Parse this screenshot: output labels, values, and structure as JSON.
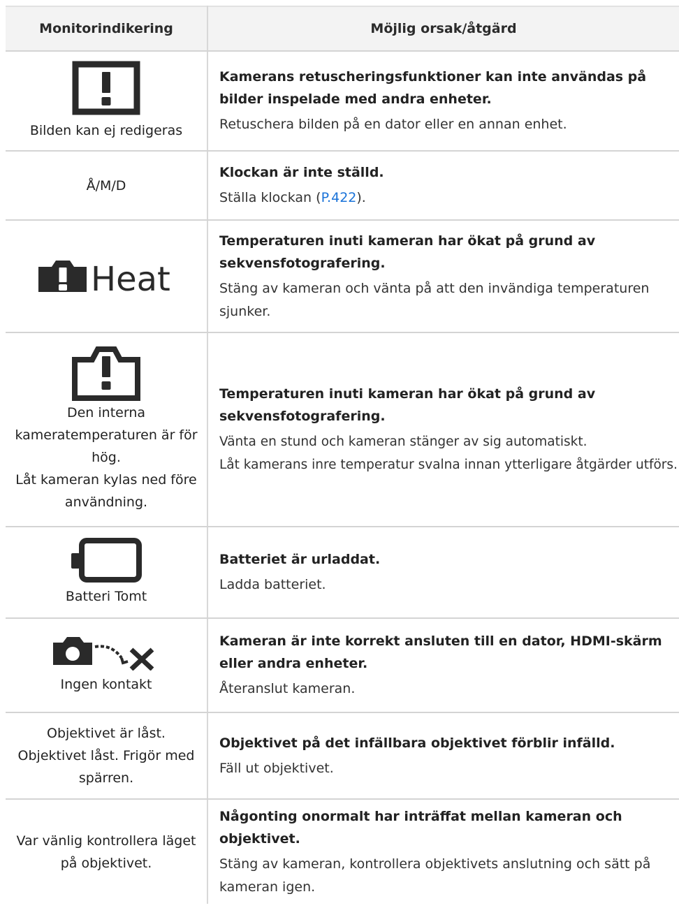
{
  "header": {
    "col1": "Monitorindikering",
    "col2": "Möjlig orsak/åtgärd"
  },
  "rows": [
    {
      "indicator": "Bilden kan ej redigeras",
      "icon": "warning-box-icon",
      "cause": "Kamerans retuscheringsfunktioner kan inte användas på bilder inspelade med andra enheter.",
      "action": "Retuschera bilden på en dator eller en annan enhet."
    },
    {
      "indicator": "Å/M/D",
      "cause": "Klockan är inte ställd.",
      "action_before": "Ställa klockan (",
      "action_link": "P.422",
      "action_after": ")."
    },
    {
      "icon": "heat-warning-icon",
      "icon_text": "Heat",
      "cause": "Temperaturen inuti kameran har ökat på grund av sekvensfotografering.",
      "action": "Stäng av kameran och vänta på att den invändiga temperaturen sjunker."
    },
    {
      "icon": "camera-warning-icon",
      "indicator_lines": [
        "Den interna",
        "kameratemperaturen är för",
        "hög.",
        "Låt kameran kylas ned före",
        "användning."
      ],
      "cause": "Temperaturen inuti kameran har ökat på grund av sekvensfotografering.",
      "action_lines": [
        "Vänta en stund och kameran stänger av sig automatiskt.",
        "Låt kamerans inre temperatur svalna innan ytterligare åtgärder utförs."
      ]
    },
    {
      "icon": "battery-empty-icon",
      "indicator": "Batteri Tomt",
      "cause": "Batteriet är urladdat.",
      "action": "Ladda batteriet."
    },
    {
      "icon": "no-connection-icon",
      "indicator": "Ingen kontakt",
      "cause": "Kameran är inte korrekt ansluten till en dator, HDMI-skärm eller andra enheter.",
      "action": "Återanslut kameran."
    },
    {
      "indicator_lines": [
        "Objektivet är låst.",
        "Objektivet låst. Frigör med",
        "spärren."
      ],
      "cause": "Objektivet på det infällbara objektivet förblir infälld.",
      "action": "Fäll ut objektivet."
    },
    {
      "indicator_lines": [
        "Var vänlig kontrollera läget",
        "på objektivet."
      ],
      "cause": "Någonting onormalt har inträffat mellan kameran och objektivet.",
      "action": "Stäng av kameran, kontrollera objektivets anslutning och sätt på kameran igen."
    }
  ],
  "colors": {
    "link": "#1a73d9",
    "header_bg": "#f3f3f3",
    "rule": "#d4d4d4",
    "icon": "#2a2a2a"
  }
}
